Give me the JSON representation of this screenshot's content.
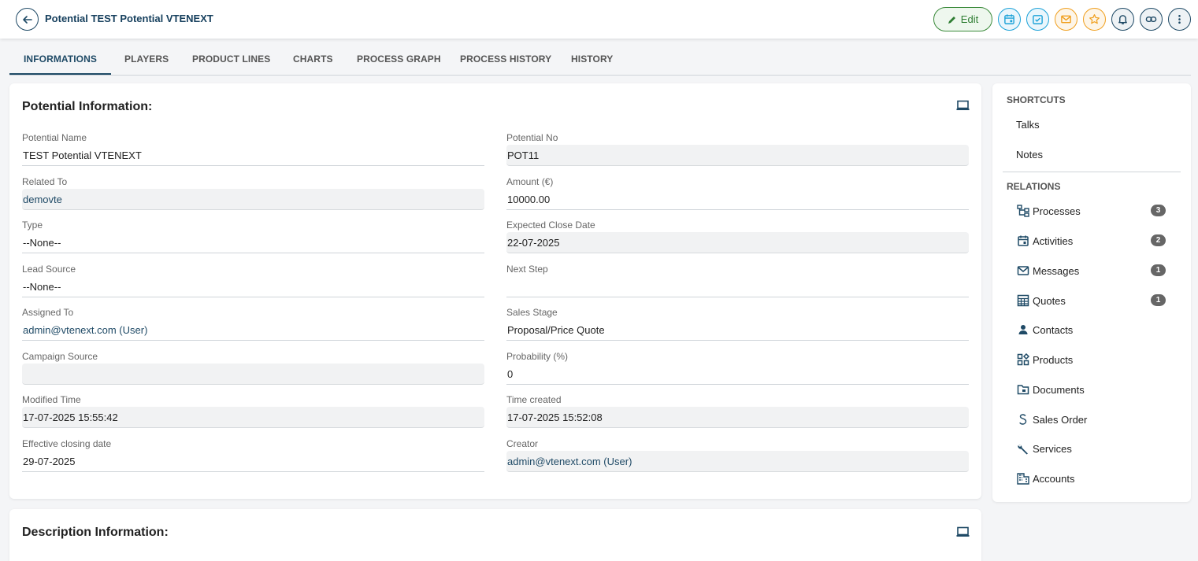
{
  "header": {
    "title": "Potential TEST Potential VTENEXT",
    "edit_label": "Edit",
    "action_icons": [
      "calendar-icon",
      "task-icon",
      "mail-icon",
      "star-icon",
      "bell-icon",
      "link-icon",
      "more-icon"
    ]
  },
  "colors": {
    "accent": "#1f4a66",
    "cyan": "#1ca2d8",
    "orange": "#f0a020",
    "green": "#2e7d32"
  },
  "tabs": [
    {
      "label": "INFORMATIONS",
      "active": true
    },
    {
      "label": "PLAYERS"
    },
    {
      "label": "PRODUCT LINES"
    },
    {
      "label": "CHARTS"
    },
    {
      "label": "PROCESS GRAPH"
    },
    {
      "label": "PROCESS HISTORY"
    },
    {
      "label": "HISTORY"
    }
  ],
  "potential_info": {
    "title": "Potential Information:",
    "fields": [
      {
        "label": "Potential Name",
        "value": "TEST Potential VTENEXT"
      },
      {
        "label": "Potential No",
        "value": "POT11"
      },
      {
        "label": "Related To",
        "value": "demovte"
      },
      {
        "label": "Amount (€)",
        "value": "10000.00"
      },
      {
        "label": "Type",
        "value": "--None--"
      },
      {
        "label": "Expected Close Date",
        "value": "22-07-2025"
      },
      {
        "label": "Lead Source",
        "value": "--None--"
      },
      {
        "label": "Next Step",
        "value": ""
      },
      {
        "label": "Assigned To",
        "value": "admin@vtenext.com (User)"
      },
      {
        "label": "Sales Stage",
        "value": "Proposal/Price Quote"
      },
      {
        "label": "Campaign Source",
        "value": ""
      },
      {
        "label": "Probability (%)",
        "value": "0"
      },
      {
        "label": "Modified Time",
        "value": "17-07-2025 15:55:42"
      },
      {
        "label": "Time created",
        "value": "17-07-2025 15:52:08"
      },
      {
        "label": "Effective closing date",
        "value": "29-07-2025"
      },
      {
        "label": "Creator",
        "value": "admin@vtenext.com (User)"
      }
    ]
  },
  "description_info": {
    "title": "Description Information:"
  },
  "sidebar": {
    "shortcuts_title": "SHORTCUTS",
    "shortcuts": [
      "Talks",
      "Notes"
    ],
    "relations_title": "RELATIONS",
    "relations": [
      {
        "label": "Processes",
        "count": "3",
        "icon": "process-icon"
      },
      {
        "label": "Activities",
        "count": "2",
        "icon": "calendar-icon"
      },
      {
        "label": "Messages",
        "count": "1",
        "icon": "mail-icon"
      },
      {
        "label": "Quotes",
        "count": "1",
        "icon": "calculator-icon"
      },
      {
        "label": "Contacts",
        "icon": "person-icon"
      },
      {
        "label": "Products",
        "icon": "products-icon"
      },
      {
        "label": "Documents",
        "icon": "folder-icon"
      },
      {
        "label": "Sales Order",
        "icon": "sales-order-icon"
      },
      {
        "label": "Services",
        "icon": "wrench-icon"
      },
      {
        "label": "Accounts",
        "icon": "building-icon"
      }
    ]
  }
}
